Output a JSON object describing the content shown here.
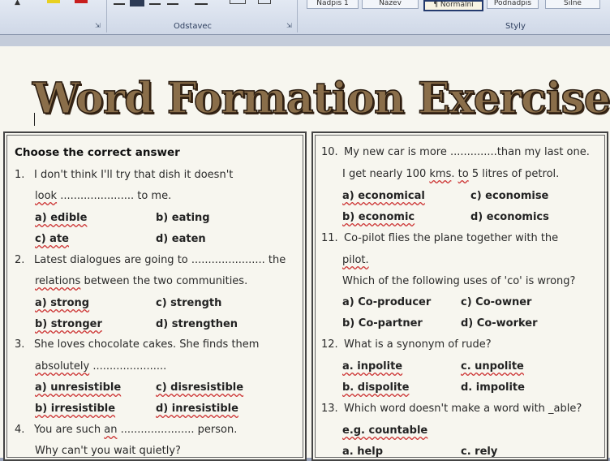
{
  "ribbon": {
    "paragraph_group_label": "Odstavec",
    "styles_group_label": "Styly",
    "styles": [
      "Nadpis 1",
      "Název",
      "¶ Normální",
      "Podnadpis",
      "Silné"
    ]
  },
  "document": {
    "title": "Word Formation Exercises",
    "left": {
      "heading": "Choose the correct answer",
      "q1": {
        "num": "1.",
        "text_a": "I don't think I'll try that dish it doesn't",
        "text_b1": "look",
        "text_b2": " ...................... to me.",
        "options": [
          "a) edible",
          "b) eating",
          "c) ate",
          "d) eaten"
        ]
      },
      "q2": {
        "num": "2.",
        "text_a": "Latest dialogues are going to ...................... the",
        "text_b1": "relations",
        "text_b2": " between the two communities.",
        "options": [
          "a) strong",
          "c) strength",
          "b) stronger",
          "d) strengthen"
        ]
      },
      "q3": {
        "num": "3.",
        "text_a": "She loves chocolate cakes. She finds them",
        "text_b1": "absolutely",
        "text_b2": " ......................",
        "options": [
          "a) unresistible",
          "c) disresistible",
          "b) irresistible",
          "d) inresistible"
        ]
      },
      "q4": {
        "num": "4.",
        "text_a1": "You are such ",
        "text_a2": "an",
        "text_a3": " ...................... person.",
        "text_b": "Why can't you wait quietly?"
      }
    },
    "right": {
      "q10": {
        "num": "10.",
        "text_a": "My new car is more ..............than my last one.",
        "text_b1": "I get nearly 100 ",
        "text_b2": "kms",
        "text_b3": ". ",
        "text_b4": "to",
        "text_b5": " 5 litres of petrol.",
        "options": [
          "a) economical",
          "c) economise",
          "b) economic",
          "d) economics"
        ]
      },
      "q11": {
        "num": "11.",
        "text_a": "Co-pilot flies the plane together with the",
        "text_b": "pilot.",
        "text_c": "Which of the following uses of 'co' is wrong?",
        "options": [
          "a) Co-producer",
          "c) Co-owner",
          "b) Co-partner",
          "d) Co-worker"
        ]
      },
      "q12": {
        "num": "12.",
        "text_a": "What is a synonym of rude?",
        "options": [
          "a. inpolite",
          "c. unpolite",
          "b. dispolite",
          "d. impolite"
        ]
      },
      "q13": {
        "num": "13.",
        "text_a": "Which word doesn't make a word with _able?",
        "example": "e.g. countable",
        "options": [
          "a. help",
          "c. rely"
        ]
      }
    }
  }
}
